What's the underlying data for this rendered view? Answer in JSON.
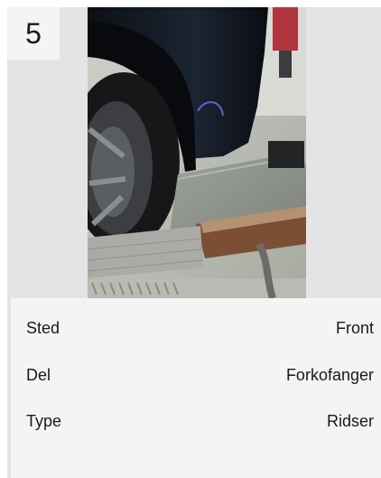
{
  "card": {
    "index": "5",
    "photo_alt": "Damage photo",
    "details": [
      {
        "label": "Sted",
        "value": "Front"
      },
      {
        "label": "Del",
        "value": "Forkofanger"
      },
      {
        "label": "Type",
        "value": "Ridser"
      }
    ]
  },
  "colors": {
    "card_bg": "#f4f4f4",
    "media_bg": "#e4e4e4",
    "text": "#1a1a1a"
  }
}
